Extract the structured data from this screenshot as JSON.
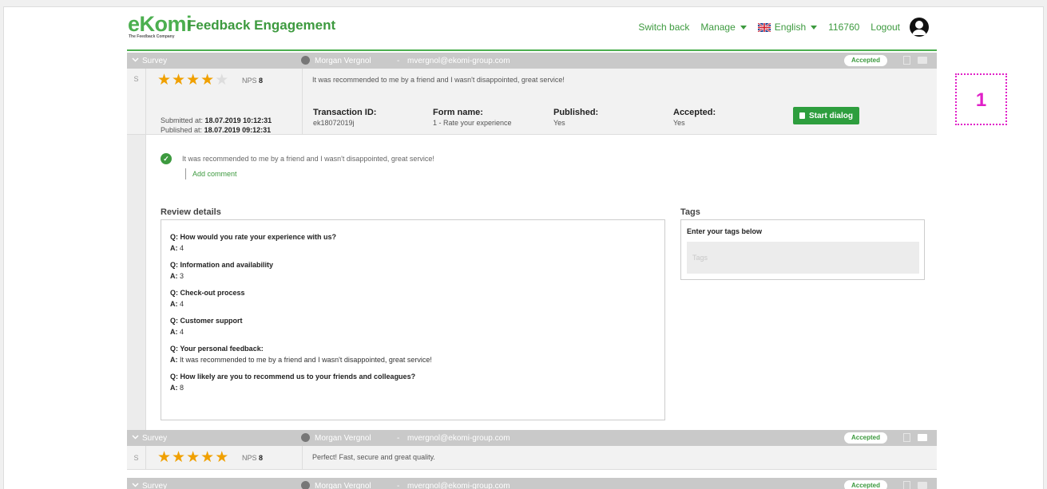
{
  "header": {
    "logo_word": "eKomi",
    "logo_tagline": "The Feedback Company",
    "app_title": "Feedback Engagement",
    "nav": {
      "switch_back": "Switch back",
      "manage": "Manage",
      "language": "English",
      "account_id": "116760",
      "logout": "Logout"
    }
  },
  "reviews": [
    {
      "type_label": "Survey",
      "user_name": "Morgan Vergnol",
      "separator": "-",
      "email": "mvergnol@ekomi-group.com",
      "status": "Accepted",
      "s_label": "S",
      "rating": 4,
      "nps_label": "NPS",
      "nps_value": "8",
      "snippet": "It was recommended to me by a friend and I wasn't disappointed, great service!",
      "submitted_label": "Submitted at:",
      "submitted_value": "18.07.2019 10:12:31",
      "published_label": "Published at:",
      "published_value": "18.07.2019 09:12:31",
      "transaction_label": "Transaction ID:",
      "transaction_value": "ek18072019j",
      "form_label": "Form name:",
      "form_value": "1 - Rate your experience",
      "published_flag_label": "Published:",
      "published_flag_value": "Yes",
      "accepted_label": "Accepted:",
      "accepted_value": "Yes",
      "start_dialog": "Start dialog",
      "comment": "It was recommended to me by a friend and I wasn't disappointed, great service!",
      "add_comment": "Add comment",
      "review_details_title": "Review details",
      "qa": [
        {
          "q": "Q: How would you rate your experience with us?",
          "a_prefix": "A:",
          "a": "4"
        },
        {
          "q": "Q: Information and availability",
          "a_prefix": "A:",
          "a": "3"
        },
        {
          "q": "Q: Check-out process",
          "a_prefix": "A:",
          "a": "4"
        },
        {
          "q": "Q: Customer support",
          "a_prefix": "A:",
          "a": "4"
        },
        {
          "q": "Q: Your personal feedback:",
          "a_prefix": "A:",
          "a": "It was recommended to me by a friend and I wasn't disappointed, great service!"
        },
        {
          "q": "Q: How likely are you to recommend us to your friends and colleagues?",
          "a_prefix": "A:",
          "a": "8"
        }
      ],
      "tags_title": "Tags",
      "tags_label": "Enter your tags below",
      "tags_placeholder": "Tags"
    },
    {
      "type_label": "Survey",
      "user_name": "Morgan Vergnol",
      "separator": "-",
      "email": "mvergnol@ekomi-group.com",
      "status": "Accepted",
      "s_label": "S",
      "rating": 5,
      "nps_label": "NPS",
      "nps_value": "8",
      "snippet": "Perfect! Fast, secure and great quality."
    },
    {
      "type_label": "Survey",
      "user_name": "Morgan Vergnol",
      "separator": "-",
      "email": "mvergnol@ekomi-group.com",
      "status": "Accepted"
    }
  ],
  "annotation": "1",
  "colors": {
    "brand": "#4caf50",
    "star": "#f0a000",
    "bar": "#c9c9c9",
    "annotation": "#e020c8"
  }
}
